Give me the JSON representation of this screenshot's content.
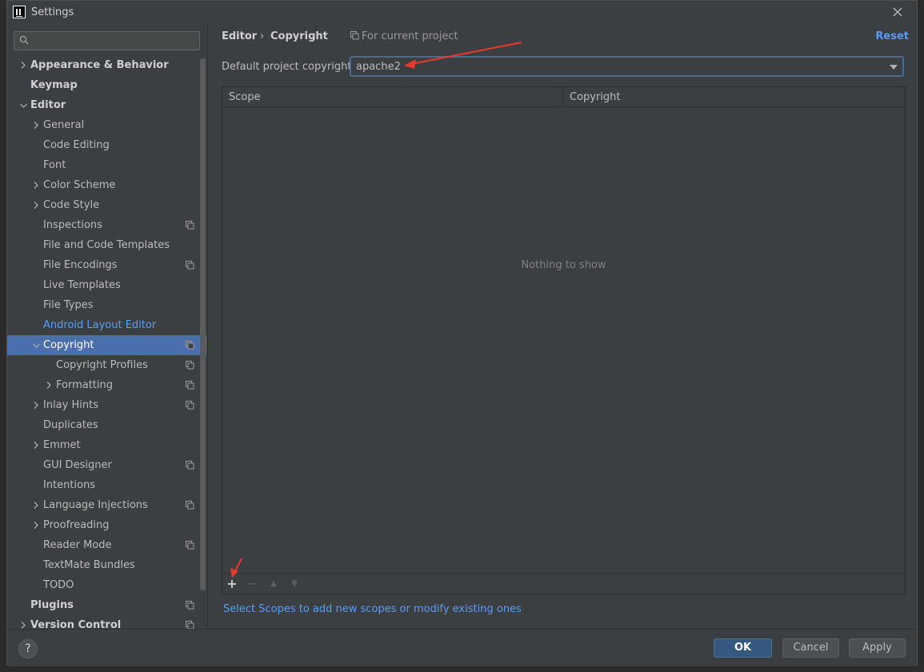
{
  "window": {
    "title": "Settings"
  },
  "search": {
    "placeholder": ""
  },
  "tree": [
    {
      "label": "Appearance & Behavior",
      "level": 0,
      "chevron": "right",
      "bold": true,
      "proj": false
    },
    {
      "label": "Keymap",
      "level": 0,
      "chevron": "none",
      "bold": true,
      "proj": false
    },
    {
      "label": "Editor",
      "level": 0,
      "chevron": "down",
      "bold": true,
      "proj": false
    },
    {
      "label": "General",
      "level": 1,
      "chevron": "right",
      "proj": false
    },
    {
      "label": "Code Editing",
      "level": 1,
      "chevron": "none",
      "proj": false
    },
    {
      "label": "Font",
      "level": 1,
      "chevron": "none",
      "proj": false
    },
    {
      "label": "Color Scheme",
      "level": 1,
      "chevron": "right",
      "proj": false
    },
    {
      "label": "Code Style",
      "level": 1,
      "chevron": "right",
      "proj": false
    },
    {
      "label": "Inspections",
      "level": 1,
      "chevron": "none",
      "proj": true
    },
    {
      "label": "File and Code Templates",
      "level": 1,
      "chevron": "none",
      "proj": false
    },
    {
      "label": "File Encodings",
      "level": 1,
      "chevron": "none",
      "proj": true
    },
    {
      "label": "Live Templates",
      "level": 1,
      "chevron": "none",
      "proj": false
    },
    {
      "label": "File Types",
      "level": 1,
      "chevron": "none",
      "proj": false
    },
    {
      "label": "Android Layout Editor",
      "level": 1,
      "chevron": "none",
      "proj": false,
      "link": true
    },
    {
      "label": "Copyright",
      "level": 1,
      "chevron": "down",
      "proj": true,
      "selected": true
    },
    {
      "label": "Copyright Profiles",
      "level": 2,
      "chevron": "none",
      "proj": true
    },
    {
      "label": "Formatting",
      "level": 2,
      "chevron": "right",
      "proj": true
    },
    {
      "label": "Inlay Hints",
      "level": 1,
      "chevron": "right",
      "proj": true
    },
    {
      "label": "Duplicates",
      "level": 1,
      "chevron": "none",
      "proj": false
    },
    {
      "label": "Emmet",
      "level": 1,
      "chevron": "right",
      "proj": false
    },
    {
      "label": "GUI Designer",
      "level": 1,
      "chevron": "none",
      "proj": true
    },
    {
      "label": "Intentions",
      "level": 1,
      "chevron": "none",
      "proj": false
    },
    {
      "label": "Language Injections",
      "level": 1,
      "chevron": "right",
      "proj": true
    },
    {
      "label": "Proofreading",
      "level": 1,
      "chevron": "right",
      "proj": false
    },
    {
      "label": "Reader Mode",
      "level": 1,
      "chevron": "none",
      "proj": true
    },
    {
      "label": "TextMate Bundles",
      "level": 1,
      "chevron": "none",
      "proj": false
    },
    {
      "label": "TODO",
      "level": 1,
      "chevron": "none",
      "proj": false
    },
    {
      "label": "Plugins",
      "level": 0,
      "chevron": "none",
      "bold": true,
      "proj": true
    },
    {
      "label": "Version Control",
      "level": 0,
      "chevron": "right",
      "bold": true,
      "proj": true
    }
  ],
  "breadcrumb": {
    "first": "Editor",
    "sep": "›",
    "second": "Copyright"
  },
  "for_project": "For current project",
  "reset_label": "Reset",
  "default_copyright": {
    "label": "Default project copyright:",
    "value": "apache2"
  },
  "table": {
    "columns": [
      "Scope",
      "Copyright"
    ],
    "empty_text": "Nothing to show",
    "toolbar": {
      "add": "+",
      "remove": "−",
      "up": "▲",
      "down": "▼"
    }
  },
  "select_scopes_link": "Select Scopes to add new scopes or modify existing ones",
  "footer": {
    "help": "?",
    "ok": "OK",
    "cancel": "Cancel",
    "apply": "Apply"
  },
  "colors": {
    "accent": "#4b6eaf",
    "link": "#589df6",
    "annotation": "#e8392c"
  }
}
